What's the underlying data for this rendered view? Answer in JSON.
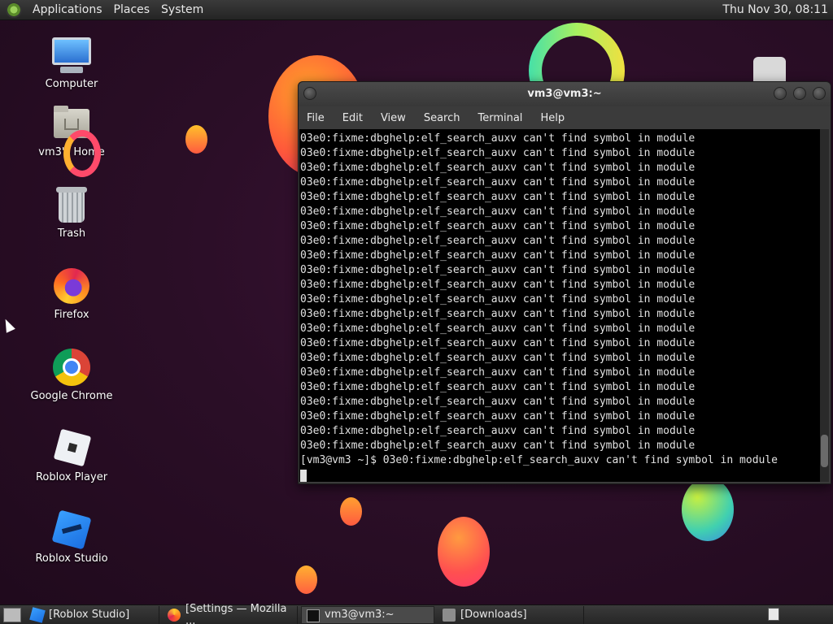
{
  "top_panel": {
    "menus": [
      "Applications",
      "Places",
      "System"
    ],
    "clock": "Thu Nov 30, 08:11"
  },
  "desktop_icons": [
    {
      "label": "Computer",
      "icon": "computer-icon"
    },
    {
      "label": "vm3's Home",
      "icon": "home-folder-icon"
    },
    {
      "label": "Trash",
      "icon": "trash-icon"
    },
    {
      "label": "Firefox",
      "icon": "firefox-icon"
    },
    {
      "label": "Google Chrome",
      "icon": "chrome-icon"
    },
    {
      "label": "Roblox Player",
      "icon": "roblox-player-icon"
    },
    {
      "label": "Roblox Studio",
      "icon": "roblox-studio-icon"
    }
  ],
  "terminal": {
    "title": "vm3@vm3:~",
    "menu": [
      "File",
      "Edit",
      "View",
      "Search",
      "Terminal",
      "Help"
    ],
    "lines": [
      "03e0:fixme:dbghelp:elf_search_auxv can't find symbol in module",
      "03e0:fixme:dbghelp:elf_search_auxv can't find symbol in module",
      "03e0:fixme:dbghelp:elf_search_auxv can't find symbol in module",
      "03e0:fixme:dbghelp:elf_search_auxv can't find symbol in module",
      "03e0:fixme:dbghelp:elf_search_auxv can't find symbol in module",
      "03e0:fixme:dbghelp:elf_search_auxv can't find symbol in module",
      "03e0:fixme:dbghelp:elf_search_auxv can't find symbol in module",
      "03e0:fixme:dbghelp:elf_search_auxv can't find symbol in module",
      "03e0:fixme:dbghelp:elf_search_auxv can't find symbol in module",
      "03e0:fixme:dbghelp:elf_search_auxv can't find symbol in module",
      "03e0:fixme:dbghelp:elf_search_auxv can't find symbol in module",
      "03e0:fixme:dbghelp:elf_search_auxv can't find symbol in module",
      "03e0:fixme:dbghelp:elf_search_auxv can't find symbol in module",
      "03e0:fixme:dbghelp:elf_search_auxv can't find symbol in module",
      "03e0:fixme:dbghelp:elf_search_auxv can't find symbol in module",
      "03e0:fixme:dbghelp:elf_search_auxv can't find symbol in module",
      "03e0:fixme:dbghelp:elf_search_auxv can't find symbol in module",
      "03e0:fixme:dbghelp:elf_search_auxv can't find symbol in module",
      "03e0:fixme:dbghelp:elf_search_auxv can't find symbol in module",
      "03e0:fixme:dbghelp:elf_search_auxv can't find symbol in module",
      "03e0:fixme:dbghelp:elf_search_auxv can't find symbol in module",
      "03e0:fixme:dbghelp:elf_search_auxv can't find symbol in module"
    ],
    "prompt_line": "[vm3@vm3 ~]$ 03e0:fixme:dbghelp:elf_search_auxv can't find symbol in module"
  },
  "taskbar": {
    "tasks": [
      {
        "label": "[Roblox Studio]",
        "icon": "roblox-studio-icon"
      },
      {
        "label": "[Settings — Mozilla ...",
        "icon": "firefox-icon"
      },
      {
        "label": "vm3@vm3:~",
        "icon": "terminal-icon"
      },
      {
        "label": "[Downloads]",
        "icon": "folder-icon"
      }
    ]
  },
  "colors": {
    "terminal_bg": "#000000",
    "terminal_fg": "#e2e2e2",
    "panel": "#2e2e2e",
    "wallpaper": "#2b0e27"
  }
}
